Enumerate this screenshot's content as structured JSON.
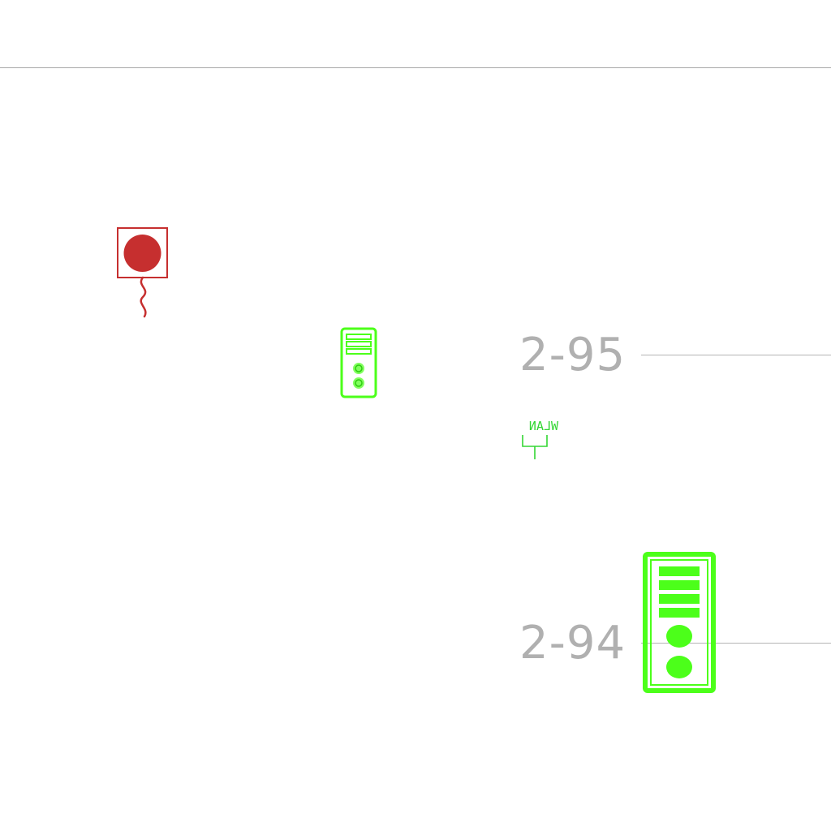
{
  "labels": {
    "room_upper": "2-95",
    "room_lower": "2-94",
    "wlan": "WLAN"
  },
  "colors": {
    "alarm": "#c62f2f",
    "intercom": "#4cff1a",
    "wlan": "#33d633",
    "label": "#b0b0b0",
    "line": "#b4b4b4"
  },
  "icons": {
    "alarm": "alarm-button-icon",
    "intercom": "door-intercom-icon",
    "wlan": "wlan-antenna-icon"
  }
}
